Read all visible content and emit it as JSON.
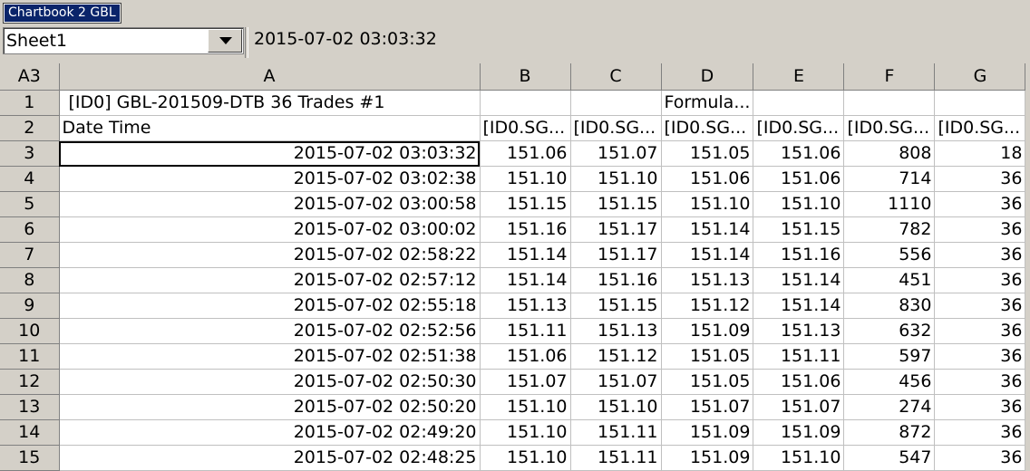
{
  "tab": {
    "label": "Chartbook 2 GBL"
  },
  "sheet_selector": {
    "value": "Sheet1"
  },
  "cell_value": "2015-07-02  03:03:32",
  "grid": {
    "corner": "A3",
    "columns": [
      "A",
      "B",
      "C",
      "D",
      "E",
      "F",
      "G"
    ],
    "row1": {
      "num": "1",
      "a": "[ID0] GBL-201509-DTB  36 Trades  #1",
      "d": "Formula..."
    },
    "row2": {
      "num": "2",
      "a": "Date Time",
      "b": "[ID0.SG...",
      "c": "[ID0.SG...",
      "d": "[ID0.SG...",
      "e": "[ID0.SG...",
      "f": "[ID0.SG...",
      "g": "[ID0.SG..."
    },
    "rows": [
      {
        "num": "3",
        "a": "2015-07-02  03:03:32",
        "b": "151.06",
        "c": "151.07",
        "d": "151.05",
        "e": "151.06",
        "f": "808",
        "g": "18"
      },
      {
        "num": "4",
        "a": "2015-07-02  03:02:38",
        "b": "151.10",
        "c": "151.10",
        "d": "151.06",
        "e": "151.06",
        "f": "714",
        "g": "36"
      },
      {
        "num": "5",
        "a": "2015-07-02  03:00:58",
        "b": "151.15",
        "c": "151.15",
        "d": "151.10",
        "e": "151.10",
        "f": "1110",
        "g": "36"
      },
      {
        "num": "6",
        "a": "2015-07-02  03:00:02",
        "b": "151.16",
        "c": "151.17",
        "d": "151.14",
        "e": "151.15",
        "f": "782",
        "g": "36"
      },
      {
        "num": "7",
        "a": "2015-07-02  02:58:22",
        "b": "151.14",
        "c": "151.17",
        "d": "151.14",
        "e": "151.16",
        "f": "556",
        "g": "36"
      },
      {
        "num": "8",
        "a": "2015-07-02  02:57:12",
        "b": "151.14",
        "c": "151.16",
        "d": "151.13",
        "e": "151.14",
        "f": "451",
        "g": "36"
      },
      {
        "num": "9",
        "a": "2015-07-02  02:55:18",
        "b": "151.13",
        "c": "151.15",
        "d": "151.12",
        "e": "151.14",
        "f": "830",
        "g": "36"
      },
      {
        "num": "10",
        "a": "2015-07-02  02:52:56",
        "b": "151.11",
        "c": "151.13",
        "d": "151.09",
        "e": "151.13",
        "f": "632",
        "g": "36"
      },
      {
        "num": "11",
        "a": "2015-07-02  02:51:38",
        "b": "151.06",
        "c": "151.12",
        "d": "151.05",
        "e": "151.11",
        "f": "597",
        "g": "36"
      },
      {
        "num": "12",
        "a": "2015-07-02  02:50:30",
        "b": "151.07",
        "c": "151.07",
        "d": "151.05",
        "e": "151.06",
        "f": "456",
        "g": "36"
      },
      {
        "num": "13",
        "a": "2015-07-02  02:50:20",
        "b": "151.10",
        "c": "151.10",
        "d": "151.07",
        "e": "151.07",
        "f": "274",
        "g": "36"
      },
      {
        "num": "14",
        "a": "2015-07-02  02:49:20",
        "b": "151.10",
        "c": "151.11",
        "d": "151.09",
        "e": "151.09",
        "f": "872",
        "g": "36"
      },
      {
        "num": "15",
        "a": "2015-07-02  02:48:25",
        "b": "151.10",
        "c": "151.11",
        "d": "151.09",
        "e": "151.10",
        "f": "547",
        "g": "36"
      }
    ]
  }
}
